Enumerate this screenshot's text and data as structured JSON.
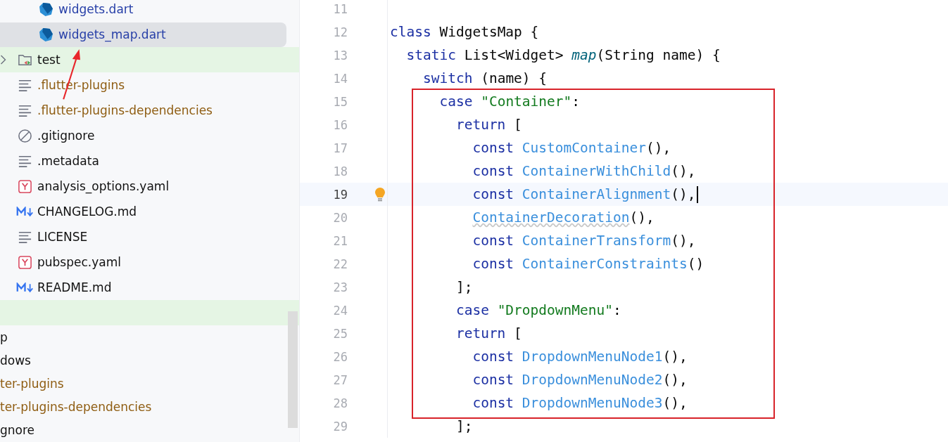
{
  "project_tree": {
    "nested_items": [
      {
        "label": "widgets.dart",
        "kind": "dart",
        "color": "#2840a8",
        "selected": false
      },
      {
        "label": "widgets_map.dart",
        "kind": "dart",
        "color": "#2840a8",
        "selected": true
      }
    ],
    "items": [
      {
        "label": "test",
        "kind": "test-folder",
        "color": "#111111",
        "selected": false,
        "expandable": true,
        "highlighted": true
      },
      {
        "label": ".flutter-plugins",
        "kind": "text",
        "color": "#8f5d12",
        "selected": false,
        "expandable": false,
        "highlighted": false
      },
      {
        "label": ".flutter-plugins-dependencies",
        "kind": "text",
        "color": "#8f5d12",
        "selected": false,
        "expandable": false,
        "highlighted": false
      },
      {
        "label": ".gitignore",
        "kind": "ignore",
        "color": "#111111",
        "selected": false,
        "expandable": false,
        "highlighted": false
      },
      {
        "label": ".metadata",
        "kind": "text",
        "color": "#111111",
        "selected": false,
        "expandable": false,
        "highlighted": false
      },
      {
        "label": "analysis_options.yaml",
        "kind": "yaml",
        "color": "#111111",
        "selected": false,
        "expandable": false,
        "highlighted": false
      },
      {
        "label": "CHANGELOG.md",
        "kind": "markdown",
        "color": "#111111",
        "selected": false,
        "expandable": false,
        "highlighted": false
      },
      {
        "label": "LICENSE",
        "kind": "text",
        "color": "#111111",
        "selected": false,
        "expandable": false,
        "highlighted": false
      },
      {
        "label": "pubspec.yaml",
        "kind": "yaml",
        "color": "#111111",
        "selected": false,
        "expandable": false,
        "highlighted": false
      },
      {
        "label": "README.md",
        "kind": "markdown",
        "color": "#111111",
        "selected": false,
        "expandable": false,
        "highlighted": false
      }
    ]
  },
  "lower_tree": {
    "items": [
      {
        "label": "p",
        "color": "#111111"
      },
      {
        "label": "dows",
        "color": "#111111"
      },
      {
        "label": "ter-plugins",
        "color": "#8f5d12"
      },
      {
        "label": "ter-plugins-dependencies",
        "color": "#8f5d12"
      },
      {
        "label": "gnore",
        "color": "#111111"
      }
    ]
  },
  "editor": {
    "lines": [
      {
        "number": "11",
        "current": false,
        "hint": false,
        "caret": false
      },
      {
        "number": "12",
        "current": false,
        "hint": false,
        "caret": false,
        "tokens": [
          {
            "text": "class ",
            "kind": "keyword"
          },
          {
            "text": "WidgetsMap {",
            "kind": "plain"
          }
        ]
      },
      {
        "number": "13",
        "current": false,
        "hint": false,
        "caret": false,
        "tokens": [
          {
            "text": "  static ",
            "kind": "keyword"
          },
          {
            "text": "List<Widget> ",
            "kind": "plain"
          },
          {
            "text": "map",
            "kind": "method"
          },
          {
            "text": "(String name) {",
            "kind": "plain"
          }
        ]
      },
      {
        "number": "14",
        "current": false,
        "hint": false,
        "caret": false,
        "tokens": [
          {
            "text": "    switch ",
            "kind": "keyword"
          },
          {
            "text": "(name) {",
            "kind": "plain"
          }
        ]
      },
      {
        "number": "15",
        "current": false,
        "hint": false,
        "caret": false,
        "tokens": [
          {
            "text": "      case ",
            "kind": "keyword"
          },
          {
            "text": "\"Container\"",
            "kind": "string"
          },
          {
            "text": ":",
            "kind": "plain"
          }
        ]
      },
      {
        "number": "16",
        "current": false,
        "hint": false,
        "caret": false,
        "tokens": [
          {
            "text": "        return ",
            "kind": "keyword"
          },
          {
            "text": "[",
            "kind": "plain"
          }
        ]
      },
      {
        "number": "17",
        "current": false,
        "hint": false,
        "caret": false,
        "tokens": [
          {
            "text": "          const ",
            "kind": "keyword"
          },
          {
            "text": "CustomContainer",
            "kind": "class"
          },
          {
            "text": "(),",
            "kind": "plain"
          }
        ]
      },
      {
        "number": "18",
        "current": false,
        "hint": false,
        "caret": false,
        "tokens": [
          {
            "text": "          const ",
            "kind": "keyword"
          },
          {
            "text": "ContainerWithChild",
            "kind": "class"
          },
          {
            "text": "(),",
            "kind": "plain"
          }
        ]
      },
      {
        "number": "19",
        "current": true,
        "hint": true,
        "caret": true,
        "tokens": [
          {
            "text": "          const ",
            "kind": "keyword"
          },
          {
            "text": "ContainerAlignment",
            "kind": "class"
          },
          {
            "text": "(),",
            "kind": "plain"
          }
        ]
      },
      {
        "number": "20",
        "current": false,
        "hint": false,
        "caret": false,
        "tokens": [
          {
            "text": "          ContainerDecoration",
            "kind": "warning"
          },
          {
            "text": "(),",
            "kind": "plain"
          }
        ]
      },
      {
        "number": "21",
        "current": false,
        "hint": false,
        "caret": false,
        "tokens": [
          {
            "text": "          const ",
            "kind": "keyword"
          },
          {
            "text": "ContainerTransform",
            "kind": "class"
          },
          {
            "text": "(),",
            "kind": "plain"
          }
        ]
      },
      {
        "number": "22",
        "current": false,
        "hint": false,
        "caret": false,
        "tokens": [
          {
            "text": "          const ",
            "kind": "keyword"
          },
          {
            "text": "ContainerConstraints",
            "kind": "class"
          },
          {
            "text": "()",
            "kind": "plain"
          }
        ]
      },
      {
        "number": "23",
        "current": false,
        "hint": false,
        "caret": false,
        "tokens": [
          {
            "text": "        ];",
            "kind": "plain"
          }
        ]
      },
      {
        "number": "24",
        "current": false,
        "hint": false,
        "caret": false,
        "tokens": [
          {
            "text": "        case ",
            "kind": "keyword"
          },
          {
            "text": "\"DropdownMenu\"",
            "kind": "string"
          },
          {
            "text": ":",
            "kind": "plain"
          }
        ]
      },
      {
        "number": "25",
        "current": false,
        "hint": false,
        "caret": false,
        "tokens": [
          {
            "text": "        return ",
            "kind": "keyword"
          },
          {
            "text": "[",
            "kind": "plain"
          }
        ]
      },
      {
        "number": "26",
        "current": false,
        "hint": false,
        "caret": false,
        "tokens": [
          {
            "text": "          const ",
            "kind": "keyword"
          },
          {
            "text": "DropdownMenuNode1",
            "kind": "class"
          },
          {
            "text": "(),",
            "kind": "plain"
          }
        ]
      },
      {
        "number": "27",
        "current": false,
        "hint": false,
        "caret": false,
        "tokens": [
          {
            "text": "          const ",
            "kind": "keyword"
          },
          {
            "text": "DropdownMenuNode2",
            "kind": "class"
          },
          {
            "text": "(),",
            "kind": "plain"
          }
        ]
      },
      {
        "number": "28",
        "current": false,
        "hint": false,
        "caret": false,
        "tokens": [
          {
            "text": "          const ",
            "kind": "keyword"
          },
          {
            "text": "DropdownMenuNode3",
            "kind": "class"
          },
          {
            "text": "(),",
            "kind": "plain"
          }
        ]
      },
      {
        "number": "29",
        "current": false,
        "hint": false,
        "caret": false,
        "tokens": [
          {
            "text": "        ];",
            "kind": "plain"
          }
        ]
      }
    ]
  }
}
